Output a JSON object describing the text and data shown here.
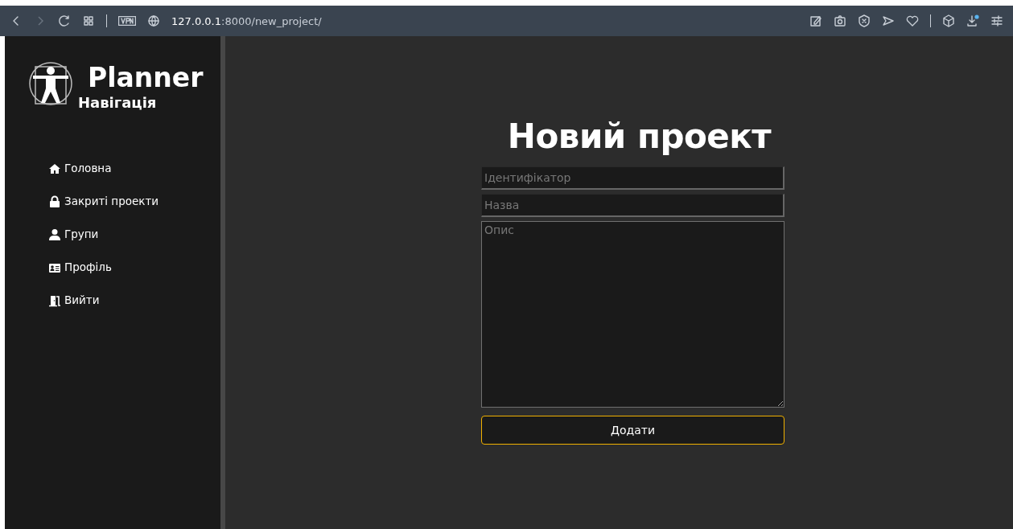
{
  "browser": {
    "address_host": "127.0.0.1",
    "address_rest": ":8000/new_project/"
  },
  "sidebar": {
    "brand": "Planner",
    "heading": "Навігація",
    "items": [
      {
        "label": "Головна",
        "kind": "home"
      },
      {
        "label": "Закриті проекти",
        "kind": "lock"
      },
      {
        "label": "Групи",
        "kind": "user"
      },
      {
        "label": "Профіль",
        "kind": "card"
      },
      {
        "label": "Вийти",
        "kind": "exit"
      }
    ]
  },
  "form": {
    "title": "Новий проект",
    "fields": [
      {
        "placeholder": "Ідентифікатор",
        "kind": "input"
      },
      {
        "placeholder": "Назва",
        "kind": "input"
      },
      {
        "placeholder": "Опис",
        "kind": "textarea"
      }
    ],
    "submit": "Додати"
  }
}
